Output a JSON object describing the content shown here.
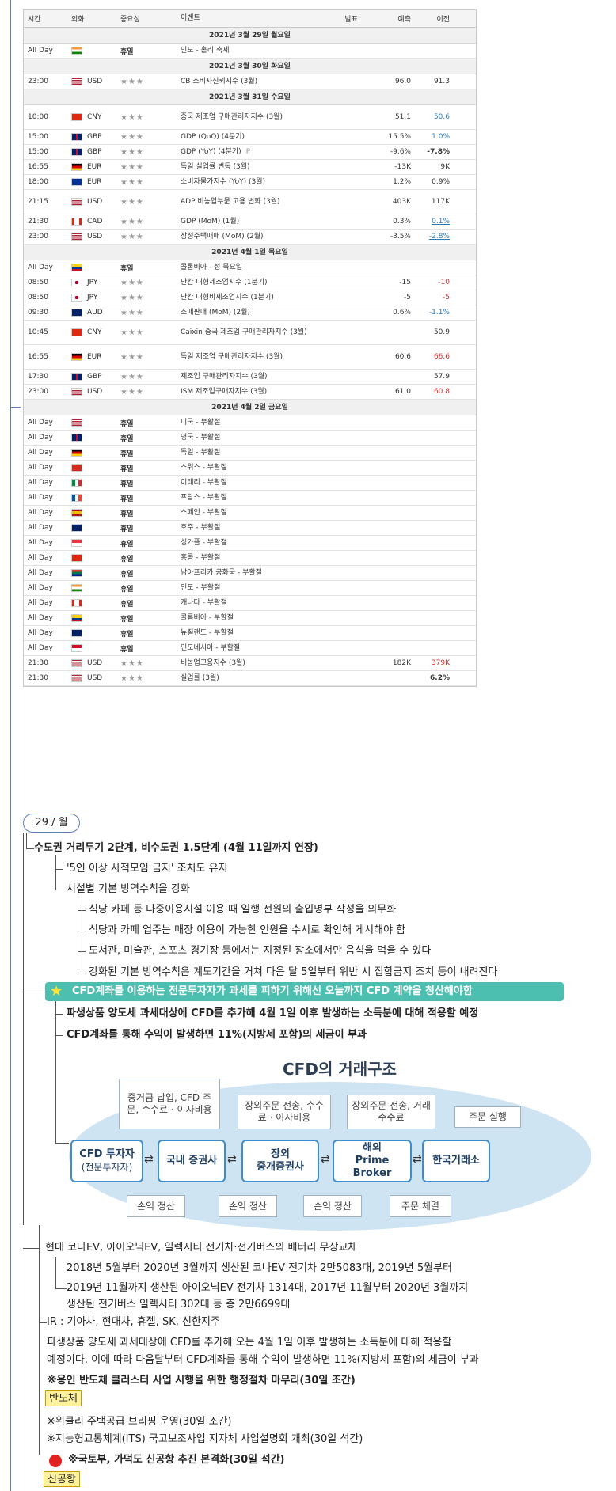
{
  "calendar": {
    "headers": {
      "time": "시간",
      "currency": "외화",
      "importance": "중요성",
      "event": "이벤트",
      "actual": "발표",
      "forecast": "예측",
      "previous": "이전"
    },
    "days": [
      {
        "date": "2021년 3월 29일 월요일",
        "rows": [
          {
            "time": "All Day",
            "flag": "IN",
            "cur": "",
            "imp": "휴일",
            "event": "인도 - 홀리 축제",
            "actual": "",
            "forecast": "",
            "prev": ""
          }
        ]
      },
      {
        "date": "2021년 3월 30일 화요일",
        "rows": [
          {
            "time": "23:00",
            "flag": "US",
            "cur": "USD",
            "imp": "★★★",
            "event": "CB 소비자신뢰지수 (3월)",
            "actual": "",
            "forecast": "96.0",
            "prev": "91.3"
          }
        ]
      },
      {
        "date": "2021년 3월 31일 수요일",
        "rows": [
          {
            "time": "10:00",
            "flag": "CN",
            "cur": "CNY",
            "imp": "★★★",
            "event": "중국 제조업 구매관리자지수 (3월)",
            "actual": "",
            "forecast": "51.1",
            "prev": "50.6",
            "pc": "blue",
            "tall": true
          },
          {
            "time": "15:00",
            "flag": "GB",
            "cur": "GBP",
            "imp": "★★★",
            "event": "GDP (QoQ) (4분기)",
            "actual": "",
            "forecast": "15.5%",
            "prev": "1.0%",
            "pc": "blue"
          },
          {
            "time": "15:00",
            "flag": "GB",
            "cur": "GBP",
            "imp": "★★★",
            "event": "GDP (YoY) (4분기)",
            "mark": "P",
            "actual": "",
            "forecast": "-9.6%",
            "prev": "-7.8%",
            "pc": "bold"
          },
          {
            "time": "16:55",
            "flag": "DE",
            "cur": "EUR",
            "imp": "★★★",
            "event": "독일 실업률 변동 (3월)",
            "actual": "",
            "forecast": "-13K",
            "prev": "9K"
          },
          {
            "time": "18:00",
            "flag": "EU",
            "cur": "EUR",
            "imp": "★★★",
            "event": "소비자물가지수 (YoY) (3월)",
            "actual": "",
            "forecast": "1.2%",
            "prev": "0.9%"
          },
          {
            "time": "21:15",
            "flag": "US",
            "cur": "USD",
            "imp": "★★★",
            "event": "ADP 비농업부문 고용 변화 (3월)",
            "actual": "",
            "forecast": "403K",
            "prev": "117K",
            "tall": true
          },
          {
            "time": "21:30",
            "flag": "CA",
            "cur": "CAD",
            "imp": "★★★",
            "event": "GDP (MoM) (1월)",
            "actual": "",
            "forecast": "0.3%",
            "prev": "0.1%",
            "pc": "blue-u"
          },
          {
            "time": "23:00",
            "flag": "US",
            "cur": "USD",
            "imp": "★★★",
            "event": "잠정주택매매 (MoM) (2월)",
            "actual": "",
            "forecast": "-3.5%",
            "prev": "-2.8%",
            "pc": "blue-u"
          }
        ]
      },
      {
        "date": "2021년 4월 1일 목요일",
        "rows": [
          {
            "time": "All Day",
            "flag": "CO",
            "cur": "",
            "imp": "휴일",
            "event": "콜롬비아 - 성 목요일",
            "actual": "",
            "forecast": "",
            "prev": ""
          },
          {
            "time": "08:50",
            "flag": "JP",
            "cur": "JPY",
            "imp": "★★★",
            "event": "단칸 대형제조업지수 (1분기)",
            "actual": "",
            "forecast": "-15",
            "prev": "-10",
            "pc": "red"
          },
          {
            "time": "08:50",
            "flag": "JP",
            "cur": "JPY",
            "imp": "★★★",
            "event": "단칸 대형비제조업지수 (1분기)",
            "actual": "",
            "forecast": "-5",
            "prev": "-5",
            "pc": "red"
          },
          {
            "time": "09:30",
            "flag": "AU",
            "cur": "AUD",
            "imp": "★★★",
            "event": "소매판매 (MoM) (2월)",
            "actual": "",
            "forecast": "0.6%",
            "prev": "-1.1%",
            "pc": "blue"
          },
          {
            "time": "10:45",
            "flag": "CN",
            "cur": "CNY",
            "imp": "★★★",
            "event": "Caixin 중국 제조업 구매관리자지수 (3월)",
            "actual": "",
            "forecast": "",
            "prev": "50.9",
            "tall": true
          },
          {
            "time": "16:55",
            "flag": "DE",
            "cur": "EUR",
            "imp": "★★★",
            "event": "독일 제조업 구매관리자지수 (3월)",
            "actual": "",
            "forecast": "60.6",
            "prev": "66.6",
            "pc": "red",
            "tall": true
          },
          {
            "time": "17:30",
            "flag": "GB",
            "cur": "GBP",
            "imp": "★★★",
            "event": "제조업 구매관리자지수 (3월)",
            "actual": "",
            "forecast": "",
            "prev": "57.9"
          },
          {
            "time": "23:00",
            "flag": "US",
            "cur": "USD",
            "imp": "★★★",
            "event": "ISM 제조업구매자지수 (3월)",
            "actual": "",
            "forecast": "61.0",
            "prev": "60.8",
            "pc": "red"
          }
        ]
      },
      {
        "date": "2021년 4월 2일 금요일",
        "rows": [
          {
            "time": "All Day",
            "flag": "US",
            "cur": "",
            "imp": "휴일",
            "event": "미국 - 부활절",
            "actual": "",
            "forecast": "",
            "prev": ""
          },
          {
            "time": "All Day",
            "flag": "GB",
            "cur": "",
            "imp": "휴일",
            "event": "영국 - 부활절",
            "actual": "",
            "forecast": "",
            "prev": ""
          },
          {
            "time": "All Day",
            "flag": "DE",
            "cur": "",
            "imp": "휴일",
            "event": "독일 - 부활절",
            "actual": "",
            "forecast": "",
            "prev": ""
          },
          {
            "time": "All Day",
            "flag": "CH",
            "cur": "",
            "imp": "휴일",
            "event": "스위스 - 부활절",
            "actual": "",
            "forecast": "",
            "prev": ""
          },
          {
            "time": "All Day",
            "flag": "IT",
            "cur": "",
            "imp": "휴일",
            "event": "이태리 - 부활절",
            "actual": "",
            "forecast": "",
            "prev": ""
          },
          {
            "time": "All Day",
            "flag": "FR",
            "cur": "",
            "imp": "휴일",
            "event": "프랑스 - 부활절",
            "actual": "",
            "forecast": "",
            "prev": ""
          },
          {
            "time": "All Day",
            "flag": "ES",
            "cur": "",
            "imp": "휴일",
            "event": "스페인 - 부활절",
            "actual": "",
            "forecast": "",
            "prev": ""
          },
          {
            "time": "All Day",
            "flag": "AU",
            "cur": "",
            "imp": "휴일",
            "event": "호주 - 부활절",
            "actual": "",
            "forecast": "",
            "prev": ""
          },
          {
            "time": "All Day",
            "flag": "SG",
            "cur": "",
            "imp": "휴일",
            "event": "싱가폴 - 부활절",
            "actual": "",
            "forecast": "",
            "prev": ""
          },
          {
            "time": "All Day",
            "flag": "HK",
            "cur": "",
            "imp": "휴일",
            "event": "홍콩 - 부활절",
            "actual": "",
            "forecast": "",
            "prev": ""
          },
          {
            "time": "All Day",
            "flag": "ZA",
            "cur": "",
            "imp": "휴일",
            "event": "남아프리카 공화국 - 부활절",
            "actual": "",
            "forecast": "",
            "prev": ""
          },
          {
            "time": "All Day",
            "flag": "IN",
            "cur": "",
            "imp": "휴일",
            "event": "인도 - 부활절",
            "actual": "",
            "forecast": "",
            "prev": ""
          },
          {
            "time": "All Day",
            "flag": "CA",
            "cur": "",
            "imp": "휴일",
            "event": "캐나다 - 부활절",
            "actual": "",
            "forecast": "",
            "prev": ""
          },
          {
            "time": "All Day",
            "flag": "CO",
            "cur": "",
            "imp": "휴일",
            "event": "콜롬비아 - 부활절",
            "actual": "",
            "forecast": "",
            "prev": ""
          },
          {
            "time": "All Day",
            "flag": "NZ",
            "cur": "",
            "imp": "휴일",
            "event": "뉴질랜드 - 부활절",
            "actual": "",
            "forecast": "",
            "prev": ""
          },
          {
            "time": "All Day",
            "flag": "ID",
            "cur": "",
            "imp": "휴일",
            "event": "인도네시아 - 부활절",
            "actual": "",
            "forecast": "",
            "prev": ""
          },
          {
            "time": "21:30",
            "flag": "US",
            "cur": "USD",
            "imp": "★★★",
            "event": "비농업고용지수 (3월)",
            "actual": "",
            "forecast": "182K",
            "prev": "379K",
            "pc": "red-u"
          },
          {
            "time": "21:30",
            "flag": "US",
            "cur": "USD",
            "imp": "★★★",
            "event": "실업률 (3월)",
            "actual": "",
            "forecast": "",
            "prev": "6.2%",
            "pc": "bold"
          }
        ]
      }
    ]
  },
  "notes": {
    "day_label": "29 / 월",
    "distancing": {
      "title": "수도권 거리두기 2단계, 비수도권 1.5단계 (4월 11일까지 연장)",
      "item1": "'5인 이상 사적모임 금지' 조치도 유지",
      "item2": "시설별 기본 방역수칙을 강화",
      "sub1": "식당 카페 등 다중이용시설 이용 때 일행 전원의 출입명부 작성을 의무화",
      "sub2": "식당과 카페 업주는 매장 이용이 가능한 인원을 수시로 확인해 게시해야 함",
      "sub3": "도서관, 미술관, 스포츠 경기장 등에서는 지정된 장소에서만 음식을 먹을 수 있다",
      "sub4": "강화된 기본 방역수칙은 계도기간을 거쳐 다음 달 5일부터 위반 시 집합금지 조치 등이 내려진다"
    },
    "cfd": {
      "headline": "CFD계좌를 이용하는 전문투자자가 과세를 피하기 위해선 오늘까지 CFD 계약을 청산해야함",
      "item1": "파생상품 양도세 과세대상에 CFD를 추가해 4월 1일 이후 발생하는 소득분에 대해 적용할 예정",
      "item2": "CFD계좌를 통해 수익이 발생하면 11%(지방세 포함)의 세금이 부과",
      "diagram": {
        "title": "CFD의 거래구조",
        "box1_main": "CFD 투자자",
        "box1_sub": "(전문투자자)",
        "box2": "국내 증권사",
        "box3_line1": "장외",
        "box3_line2": "중개증권사",
        "box4_line1": "해외",
        "box4_line2": "Prime Broker",
        "box5": "한국거래소",
        "top1": "증거금 납입, CFD 주문, 수수료 · 이자비용",
        "top2": "장외주문 전송, 수수료 · 이자비용",
        "top3": "장외주문 전송, 거래수수료",
        "top4": "주문 실행",
        "bot1": "손익 정산",
        "bot2": "손익 정산",
        "bot3": "손익 정산",
        "bot4": "주문 체결"
      }
    },
    "battery": {
      "title": "현대 코나EV, 아이오닉EV, 일렉시티 전기차·전기버스의 배터리 무상교체",
      "line1": "2018년 5월부터 2020년 3월까지 생산된 코나EV 전기차 2만5083대, 2019년 5월부터",
      "line2": "2019년 11월까지 생산된 아이오닉EV 전기차 1314대, 2017년 11월부터 2020년 3월까지",
      "line3": "생산된 전기버스 일렉시티 302대 등 총 2만6699대"
    },
    "ir": "IR : 기아차, 현대차, 휴젤, SK, 신한지주",
    "tax_line1": "파생상품 양도세 과세대상에 CFD를 추가해 오는 4월 1일 이후 발생하는 소득분에 대해 적용할",
    "tax_line2": "예정이다. 이에 따라 다음달부터 CFD계좌를 통해 수익이 발생하면 11%(지방세 포함)의 세금이 부과",
    "yongin": "※용인 반도체 클러스터 사업 시행을 위한 행정절차 마무리(30일 조간)",
    "tag_semi": "반도체",
    "weekly": "※위클리 주택공급 브리핑 운영(30일 조간)",
    "its": "※지능형교통체계(ITS) 국고보조사업 지자체 사업설명회 개최(30일 석간)",
    "gadeok": "※국토부, 가덕도 신공항 추진 본격화(30일 석간)",
    "tag_airport": "신공항"
  }
}
